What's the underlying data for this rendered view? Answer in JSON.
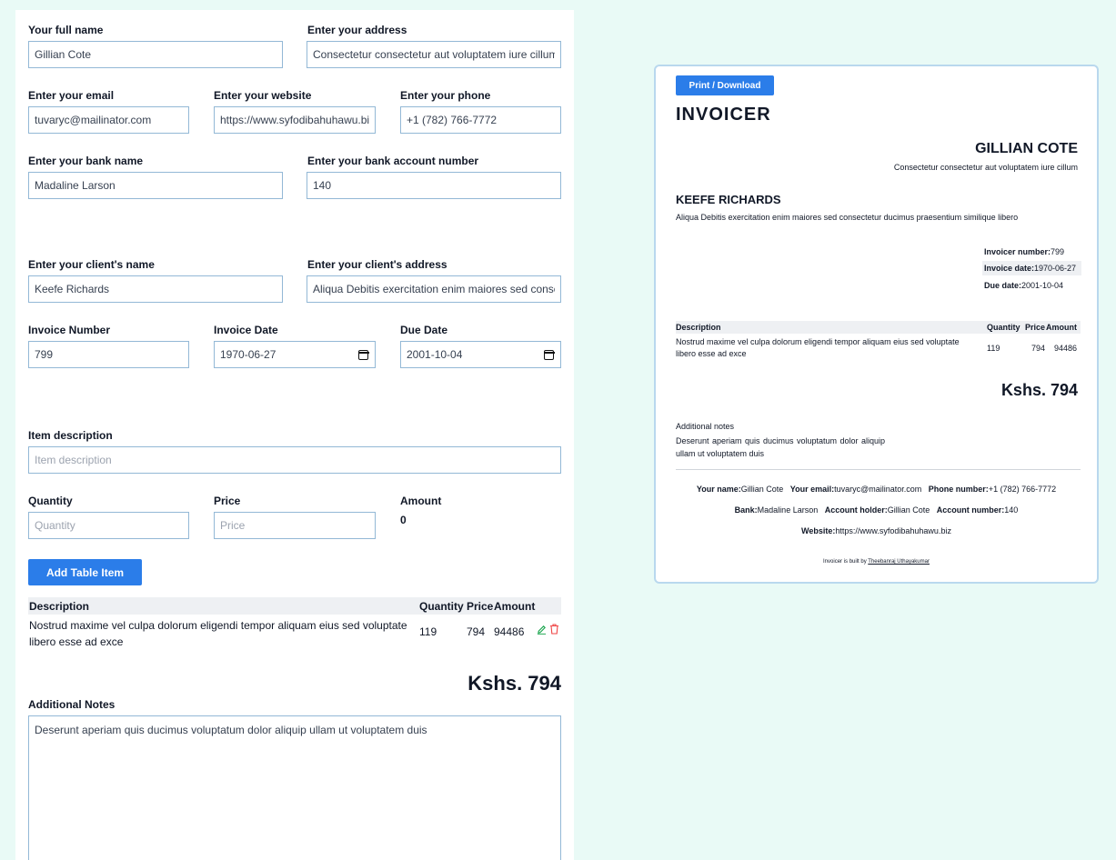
{
  "form": {
    "full_name": {
      "label": "Your full name",
      "value": "Gillian Cote"
    },
    "address": {
      "label": "Enter your address",
      "value": "Consectetur consectetur aut voluptatem iure cillum"
    },
    "email": {
      "label": "Enter your email",
      "value": "tuvaryc@mailinator.com"
    },
    "website": {
      "label": "Enter your website",
      "value": "https://www.syfodibahuhawu.biz"
    },
    "phone": {
      "label": "Enter your phone",
      "value": "+1 (782) 766-7772"
    },
    "bank_name": {
      "label": "Enter your bank name",
      "value": "Madaline Larson"
    },
    "bank_account": {
      "label": "Enter your bank account number",
      "value": "140"
    },
    "client_name": {
      "label": "Enter your client's name",
      "value": "Keefe Richards"
    },
    "client_address": {
      "label": "Enter your client's address",
      "value": "Aliqua Debitis exercitation enim maiores sed consectetur ducimus praesentium similique libero"
    },
    "invoice_number": {
      "label": "Invoice Number",
      "value": "799"
    },
    "invoice_date": {
      "label": "Invoice Date",
      "value": "1970-06-27"
    },
    "due_date": {
      "label": "Due Date",
      "value": "2001-10-04"
    },
    "item_description": {
      "label": "Item description",
      "placeholder": "Item description"
    },
    "quantity": {
      "label": "Quantity",
      "placeholder": "Quantity"
    },
    "price": {
      "label": "Price",
      "placeholder": "Price"
    },
    "amount": {
      "label": "Amount",
      "value": "0"
    },
    "add_button": "Add Table Item",
    "table": {
      "headers": {
        "description": "Description",
        "quantity": "Quantity",
        "price": "Price",
        "amount": "Amount"
      },
      "rows": [
        {
          "description": "Nostrud maxime vel culpa dolorum eligendi tempor aliquam eius sed voluptate libero esse ad exce",
          "quantity": "119",
          "price": "794",
          "amount": "94486"
        }
      ]
    },
    "total": "Kshs. 794",
    "notes": {
      "label": "Additional Notes",
      "value": "Deserunt aperiam quis ducimus voluptatum dolor aliquip ullam ut voluptatem duis"
    }
  },
  "preview": {
    "print_button": "Print / Download",
    "brand": "INVOICER",
    "name": "GILLIAN COTE",
    "address": "Consectetur consectetur aut voluptatem iure cillum",
    "client_name": "KEEFE RICHARDS",
    "client_address": "Aliqua Debitis exercitation enim maiores sed consectetur ducimus praesentium similique libero",
    "meta": {
      "invoice_number_label": "Invoicer number:",
      "invoice_number": "799",
      "invoice_date_label": "Invoice date:",
      "invoice_date": "1970-06-27",
      "due_date_label": "Due date:",
      "due_date": "2001-10-04"
    },
    "table": {
      "headers": {
        "description": "Description",
        "quantity": "Quantity",
        "price": "Price",
        "amount": "Amount"
      },
      "rows": [
        {
          "description": "Nostrud maxime vel culpa dolorum eligendi tempor aliquam eius sed voluptate libero esse ad exce",
          "quantity": "119",
          "price": "794",
          "amount": "94486"
        }
      ]
    },
    "total": "Kshs. 794",
    "notes_heading": "Additional notes",
    "notes": "Deserunt aperiam quis ducimus voluptatum dolor aliquip ullam ut voluptatem duis",
    "footer": {
      "name_label": "Your name:",
      "name": "Gillian Cote",
      "email_label": "Your email:",
      "email": "tuvaryc@mailinator.com",
      "phone_label": "Phone number:",
      "phone": "+1 (782) 766-7772",
      "bank_label": "Bank:",
      "bank": "Madaline Larson",
      "holder_label": "Account holder:",
      "holder": "Gillian Cote",
      "account_label": "Account number:",
      "account": "140",
      "website_label": "Website:",
      "website": "https://www.syfodibahuhawu.biz",
      "built_by": "Invoicer is built by",
      "author": "Theebanraj Uthayakumar"
    }
  },
  "colors": {
    "accent": "#2b7de9",
    "background": "#e9faf6",
    "input_border": "#93b8d6",
    "table_header": "#eef0f3"
  }
}
